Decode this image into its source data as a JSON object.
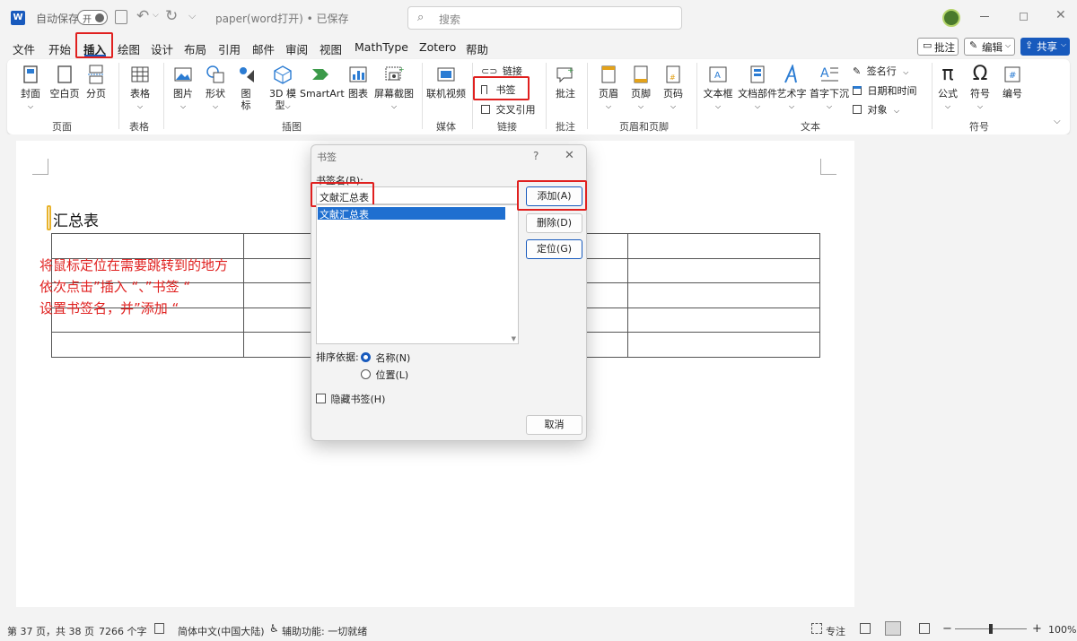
{
  "titlebar": {
    "autosave_label": "自动保存",
    "autosave_toggle": "开",
    "doc_title": "paper(word打开) • 已保存",
    "search_placeholder": "搜索"
  },
  "menu": {
    "items": [
      "文件",
      "开始",
      "插入",
      "绘图",
      "设计",
      "布局",
      "引用",
      "邮件",
      "审阅",
      "视图",
      "MathType",
      "Zotero",
      "帮助"
    ],
    "comment_btn": "批注",
    "edit_btn": "编辑",
    "share_btn": "共享"
  },
  "ribbon": {
    "page_group": {
      "label": "页面",
      "cover": "封面",
      "blank": "空白页",
      "break": "分页"
    },
    "table_group": {
      "label": "表格",
      "table": "表格"
    },
    "illus_group": {
      "label": "插图",
      "picture": "图片",
      "shape": "形状",
      "icon_line1": "图",
      "icon_line2": "标",
      "model_line1": "3D 模",
      "model_line2": "型",
      "smartart": "SmartArt",
      "chart": "图表",
      "screenshot": "屏幕截图"
    },
    "media_group": {
      "label": "媒体",
      "video": "联机视频"
    },
    "link_group": {
      "label": "链接",
      "link": "链接",
      "bookmark": "书签",
      "crossref": "交叉引用"
    },
    "comment_group": {
      "label": "批注",
      "comment": "批注"
    },
    "hf_group": {
      "label": "页眉和页脚",
      "header": "页眉",
      "footer": "页脚",
      "pagenum": "页码"
    },
    "text_group": {
      "label": "文本",
      "textbox": "文本框",
      "parts": "文档部件",
      "wordart": "艺术字",
      "dropcap": "首字下沉",
      "sigline": "签名行",
      "datetime": "日期和时间",
      "object": "对象"
    },
    "symbol_group": {
      "label": "符号",
      "equation": "公式",
      "symbol": "符号",
      "number": "编号"
    }
  },
  "document": {
    "heading": "汇总表",
    "annotation_lines": [
      "将鼠标定位在需要跳转到的地方",
      "依次点击”插入 “、”书签 “",
      "设置书签名，并”添加 “"
    ]
  },
  "dialog": {
    "title": "书签",
    "help": "?",
    "close": "✕",
    "name_label": "书签名(B):",
    "name_value": "文献汇总表",
    "list_items": [
      "文献汇总表"
    ],
    "add": "添加(A)",
    "delete": "删除(D)",
    "goto": "定位(G)",
    "sort_label": "排序依据:",
    "sort_name": "名称(N)",
    "sort_location": "位置(L)",
    "hidden": "隐藏书签(H)",
    "cancel": "取消"
  },
  "status": {
    "page": "第 37 页，共 38 页",
    "words": "7266 个字",
    "language": "简体中文(中国大陆)",
    "accessibility": "辅助功能: 一切就绪",
    "focus": "专注",
    "zoom": "100%"
  }
}
